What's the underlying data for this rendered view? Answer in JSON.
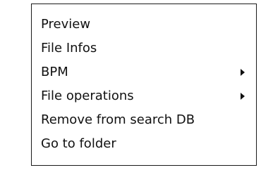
{
  "context_menu": {
    "items": [
      {
        "label": "Preview",
        "has_submenu": false
      },
      {
        "label": "File Infos",
        "has_submenu": false
      },
      {
        "label": "BPM",
        "has_submenu": true,
        "submenu_icon": "submenu-arrow-icon"
      },
      {
        "label": "File operations",
        "has_submenu": true,
        "submenu_icon": "submenu-arrow-icon"
      },
      {
        "label": "Remove from search DB",
        "has_submenu": false
      },
      {
        "label": "Go to folder",
        "has_submenu": false
      }
    ]
  }
}
